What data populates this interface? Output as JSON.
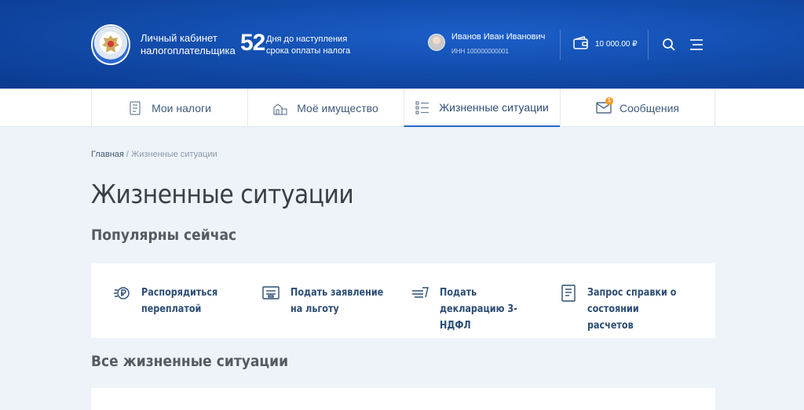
{
  "header": {
    "cabinet_title": "Личный кабинет налогоплательщика",
    "days_count": "52",
    "days_text": "Дня до наступления срока оплаты налога",
    "user_name": "Иванов Иван Иванович",
    "user_inn": "ИНН 100000000001",
    "balance": "10 000.00 ₽"
  },
  "nav": {
    "tabs": [
      {
        "label": "Мои налоги",
        "icon": "taxes-icon"
      },
      {
        "label": "Моё имущество",
        "icon": "property-icon"
      },
      {
        "label": "Жизненные ситуации",
        "icon": "list-icon",
        "active": true
      },
      {
        "label": "Сообщения",
        "icon": "envelope-icon",
        "badge": "1"
      }
    ]
  },
  "breadcrumb": {
    "home": "Главная",
    "separator": " / ",
    "current": "Жизненные ситуации"
  },
  "page_title": "Жизненные ситуации",
  "popular": {
    "title": "Популярны сейчас",
    "items": [
      {
        "label": "Распорядиться переплатой",
        "icon": "ruble-coins-icon"
      },
      {
        "label": "Подать заявление на льготу",
        "icon": "application-icon"
      },
      {
        "label": "Подать декларацию 3-НДФЛ",
        "icon": "declaration-icon"
      },
      {
        "label": "Запрос справки о состоянии расчетов",
        "icon": "document-icon"
      }
    ]
  },
  "all_situations": {
    "title": "Все жизненные ситуации"
  },
  "colors": {
    "header_blue": "#114aa8",
    "accent": "#2968c8",
    "badge": "#f59a23",
    "link": "#2c4d73"
  }
}
